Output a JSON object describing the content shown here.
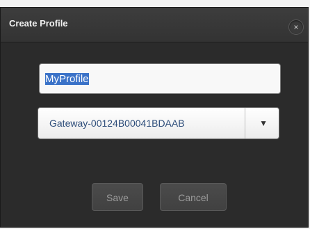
{
  "dialog": {
    "title": "Create Profile",
    "close_glyph": "×",
    "close_icon": "close-icon"
  },
  "form": {
    "profile_name_value": "MyProfile",
    "gateway_selected": "Gateway-00124B00041BDAAB",
    "dropdown_glyph": "▼",
    "dropdown_icon": "chevron-down-icon"
  },
  "buttons": {
    "save": "Save",
    "cancel": "Cancel"
  },
  "colors": {
    "dialog_bg": "#2b2b2b",
    "selection": "#3a72c8"
  }
}
